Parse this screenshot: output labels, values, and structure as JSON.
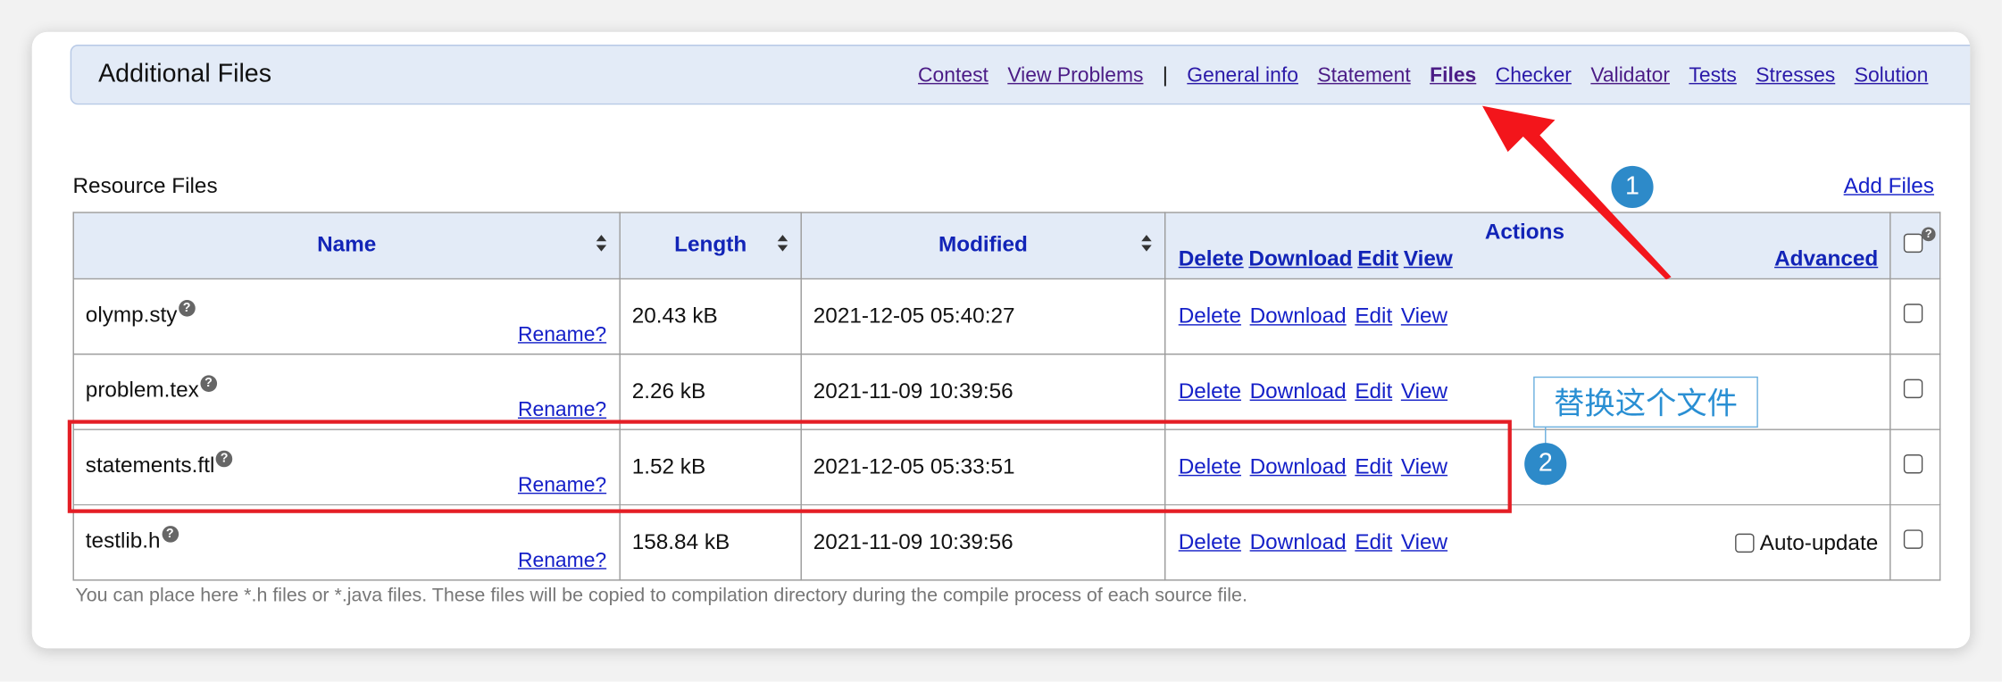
{
  "header": {
    "title": "Additional Files",
    "nav": [
      {
        "label": "Contest",
        "state": "visited"
      },
      {
        "label": "View Problems",
        "state": "visited"
      },
      {
        "label": "|",
        "state": "separator"
      },
      {
        "label": "General info",
        "state": "link"
      },
      {
        "label": "Statement",
        "state": "visited"
      },
      {
        "label": "Files",
        "state": "active"
      },
      {
        "label": "Checker",
        "state": "link"
      },
      {
        "label": "Validator",
        "state": "visited"
      },
      {
        "label": "Tests",
        "state": "link"
      },
      {
        "label": "Stresses",
        "state": "link"
      },
      {
        "label": "Solution",
        "state": "link"
      }
    ]
  },
  "section": {
    "title": "Resource Files",
    "add_files": "Add Files"
  },
  "table": {
    "columns": {
      "name": "Name",
      "length": "Length",
      "modified": "Modified",
      "actions": "Actions",
      "advanced": "Advanced",
      "bulk_actions": [
        "Delete",
        "Download",
        "Edit",
        "View"
      ]
    },
    "rows": [
      {
        "name": "olymp.sty",
        "rename": "Rename?",
        "length": "20.43 kB",
        "modified": "2021-12-05 05:40:27",
        "actions": [
          "Delete",
          "Download",
          "Edit",
          "View"
        ]
      },
      {
        "name": "problem.tex",
        "rename": "Rename?",
        "length": "2.26 kB",
        "modified": "2021-11-09 10:39:56",
        "actions": [
          "Delete",
          "Download",
          "Edit",
          "View"
        ]
      },
      {
        "name": "statements.ftl",
        "rename": "Rename?",
        "length": "1.52 kB",
        "modified": "2021-12-05 05:33:51",
        "actions": [
          "Delete",
          "Download",
          "Edit",
          "View"
        ]
      },
      {
        "name": "testlib.h",
        "rename": "Rename?",
        "length": "158.84 kB",
        "modified": "2021-11-09 10:39:56",
        "actions": [
          "Delete",
          "Download",
          "Edit",
          "View"
        ],
        "extra": "Auto-update"
      }
    ]
  },
  "note": "You can place here *.h files or *.java files. These files will be copied to compilation directory during the compile process of each source file.",
  "annotations": {
    "badge1": "1",
    "badge2": "2",
    "label": "替换这个文件",
    "highlight_color": "#e41e25",
    "badge_color": "#2d8ac9"
  },
  "help_glyph": "?"
}
